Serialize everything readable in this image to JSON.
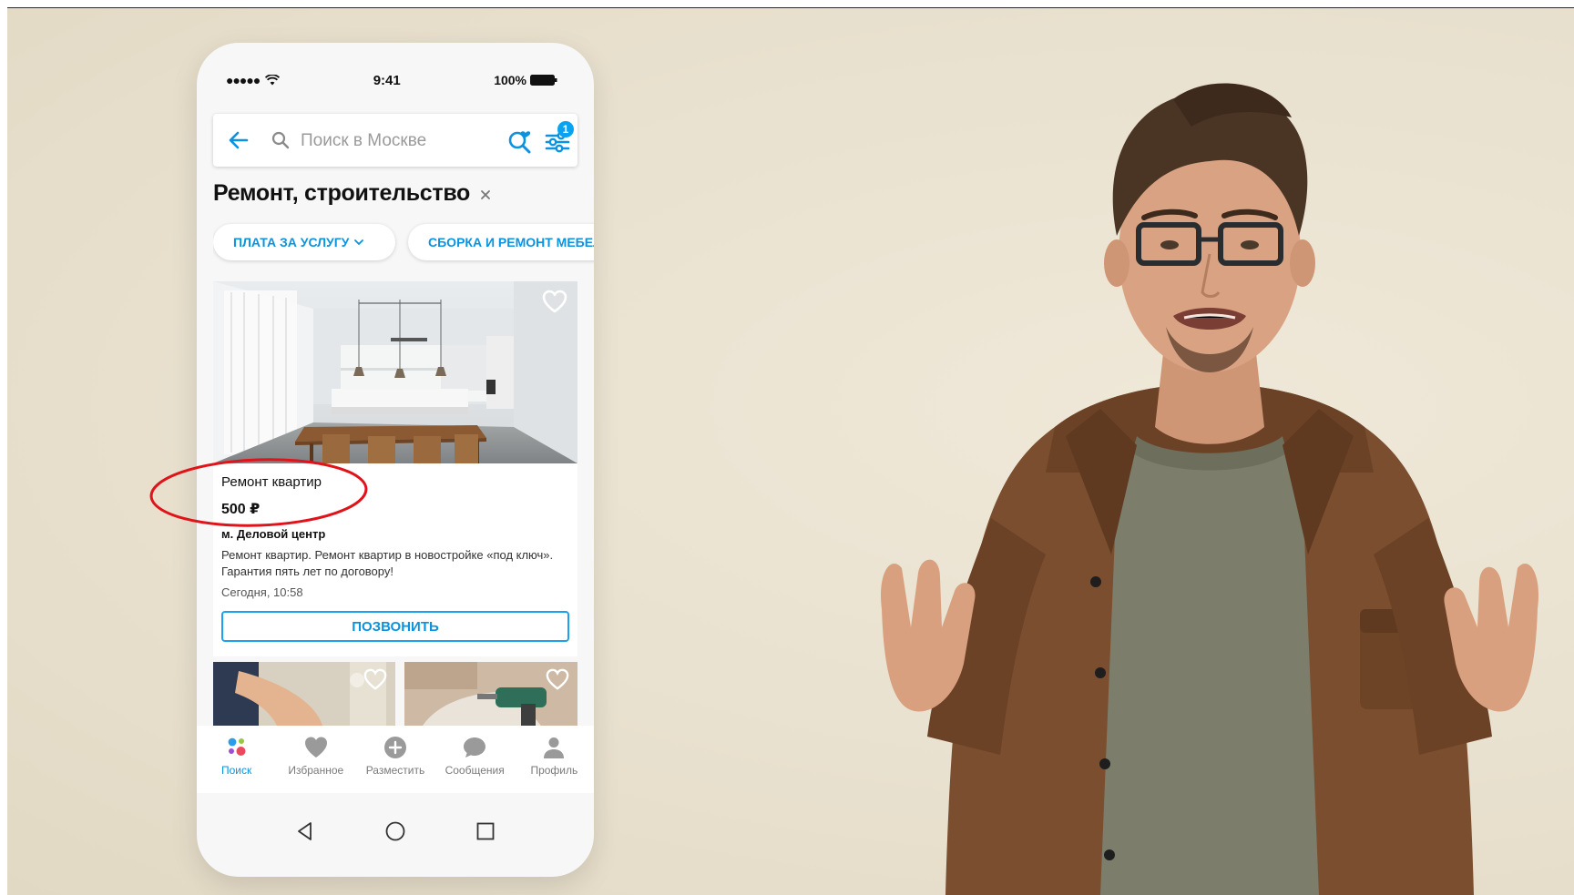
{
  "status_bar": {
    "time": "9:41",
    "battery": "100%"
  },
  "search": {
    "placeholder": "Поиск в Москве",
    "filter_count": "1"
  },
  "category": {
    "title": "Ремонт, строительство"
  },
  "chips": [
    {
      "label": "ПЛАТА ЗА УСЛУГУ"
    },
    {
      "label": "СБОРКА  И РЕМОНТ МЕБЕЛИ"
    }
  ],
  "listing": {
    "title": "Ремонт квартир",
    "price": "500 ₽",
    "metro": "м. Деловой центр",
    "description": "Ремонт квартир. Ремонт квартир в новостройке «под ключ». Гарантия пять лет по договору!",
    "date": "Сегодня, 10:58",
    "call_label": "ПОЗВОНИТЬ"
  },
  "tabs": [
    {
      "label": "Поиск",
      "icon": "search-dots-icon"
    },
    {
      "label": "Избранное",
      "icon": "heart-icon"
    },
    {
      "label": "Разместить",
      "icon": "plus-circle-icon"
    },
    {
      "label": "Сообщения",
      "icon": "chat-bubble-icon"
    },
    {
      "label": "Профиль",
      "icon": "person-icon"
    }
  ],
  "colors": {
    "accent": "#0A93E0",
    "highlight": "#E0131A",
    "background": "#EAE2D0"
  }
}
